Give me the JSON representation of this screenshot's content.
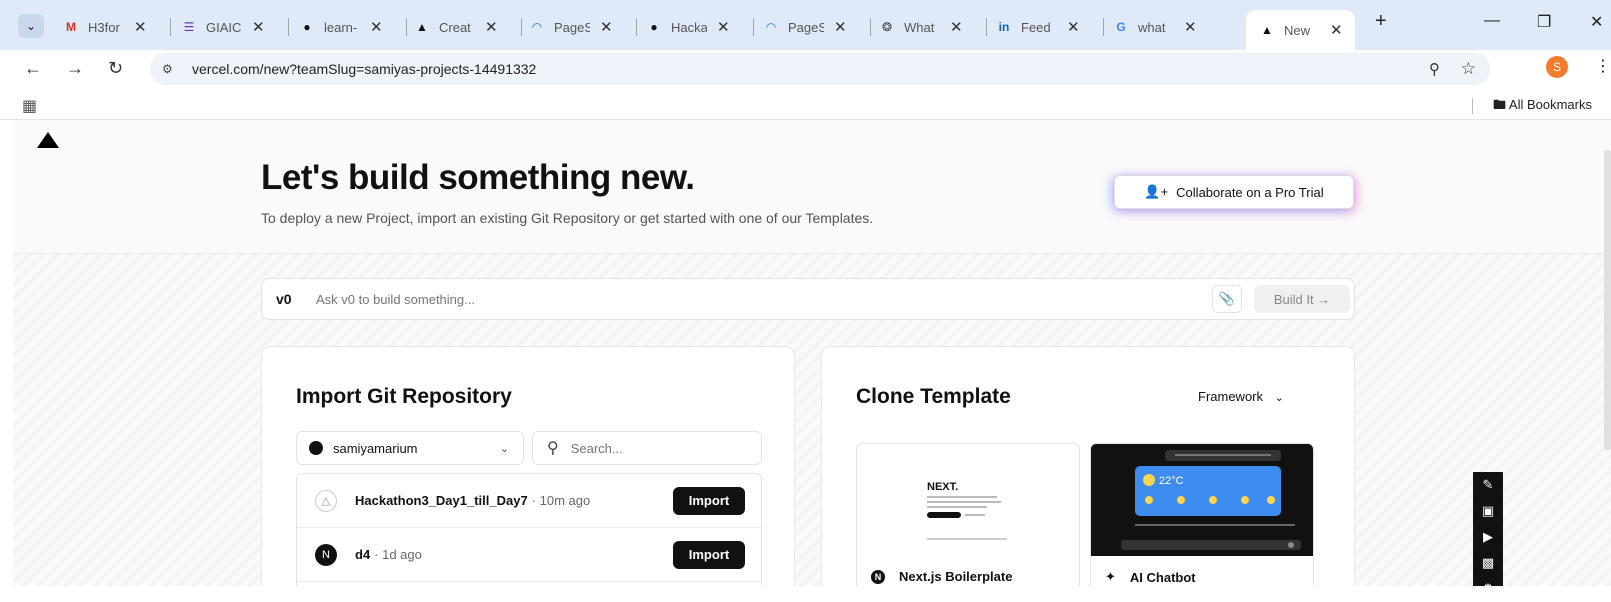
{
  "browser": {
    "tabs": [
      {
        "label": "H3for",
        "icon": "gmail-icon",
        "color": "#d93025"
      },
      {
        "label": "GIAIC",
        "icon": "forms-icon",
        "color": "#673ab7"
      },
      {
        "label": "learn-",
        "icon": "github-icon",
        "color": "#111111"
      },
      {
        "label": "Creat",
        "icon": "vercel-icon",
        "color": "#111111"
      },
      {
        "label": "PageS",
        "icon": "pagespeed-icon",
        "color": "#1a73e8"
      },
      {
        "label": "Hacka",
        "icon": "github-icon",
        "color": "#111111"
      },
      {
        "label": "PageS",
        "icon": "pagespeed-icon",
        "color": "#1a73e8"
      },
      {
        "label": "What",
        "icon": "chatgpt-icon",
        "color": "#444444"
      },
      {
        "label": "Feed",
        "icon": "linkedin-icon",
        "color": "#0a66c2"
      },
      {
        "label": "what",
        "icon": "google-icon",
        "color": "#4285f4"
      },
      {
        "label": "New",
        "icon": "vercel-icon",
        "color": "#111111",
        "active": true
      }
    ],
    "url": "vercel.com/new?teamSlug=samiyas-projects-14491332",
    "profile_initial": "S",
    "bookmarks_label": "All Bookmarks"
  },
  "hero": {
    "title": "Let's build something new.",
    "subtitle": "To deploy a new Project, import an existing Git Repository or get started with one of our Templates.",
    "pro_button": "Collaborate on a Pro Trial"
  },
  "v0": {
    "logo": "v0",
    "placeholder": "Ask v0 to build something...",
    "build_button": "Build It →"
  },
  "import": {
    "title": "Import Git Repository",
    "account": "samiyamarium",
    "search_placeholder": "Search...",
    "repos": [
      {
        "name": "Hackathon3_Day1_till_Day7",
        "time": "· 10m ago",
        "button": "Import"
      },
      {
        "name": "d4",
        "time": "· 1d ago",
        "button": "Import"
      }
    ]
  },
  "clone": {
    "title": "Clone Template",
    "framework_label": "Framework",
    "templates": [
      {
        "name": "Next.js Boilerplate"
      },
      {
        "name": "AI Chatbot"
      }
    ],
    "chatbot_temp": "22°C"
  }
}
